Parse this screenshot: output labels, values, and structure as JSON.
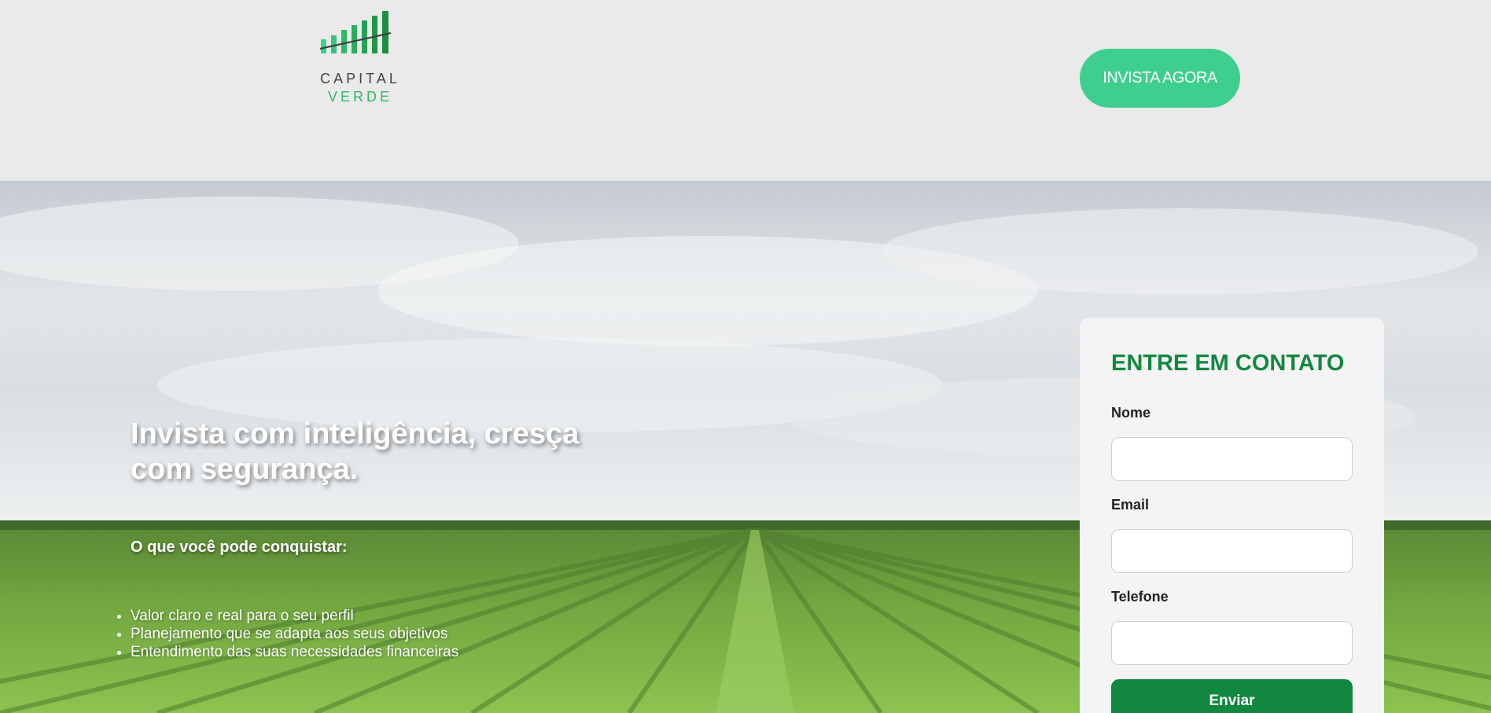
{
  "brand": {
    "line1": "CAPITAL",
    "line2": "VERDE",
    "accent": "#2fb866"
  },
  "header": {
    "cta_label": "INVISTA AGORA",
    "cta_color": "#3ecf8e"
  },
  "hero": {
    "headline": "Invista com inteligência, cresça com segurança.",
    "subheading": "O que você pode conquistar:",
    "benefits": [
      "Valor claro e real para o seu perfil",
      "Planejamento que se adapta aos seus objetivos",
      "Entendimento das suas necessidades financeiras"
    ]
  },
  "contact_form": {
    "title": "ENTRE EM CONTATO",
    "title_color": "#12873f",
    "fields": [
      {
        "label": "Nome",
        "value": ""
      },
      {
        "label": "Email",
        "value": ""
      },
      {
        "label": "Telefone",
        "value": ""
      }
    ],
    "submit_label": "Enviar"
  }
}
